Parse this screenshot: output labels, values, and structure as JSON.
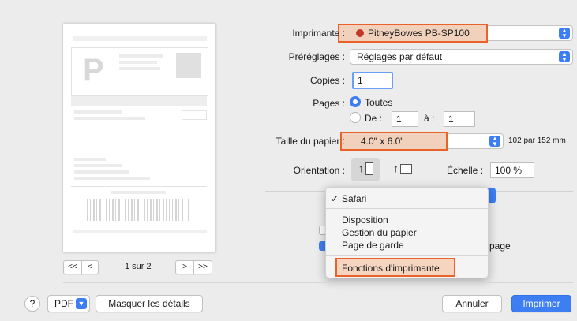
{
  "preview": {
    "logo_letter": "P",
    "page_indicator": "1 sur 2",
    "first_page": "<<",
    "prev_page": "<",
    "next_page": ">",
    "last_page": ">>"
  },
  "printer": {
    "label": "Imprimante :",
    "value": "PitneyBowes PB-SP100"
  },
  "presets": {
    "label": "Préréglages :",
    "value": "Réglages par défaut"
  },
  "copies": {
    "label": "Copies :",
    "value": "1"
  },
  "pages": {
    "label": "Pages :",
    "all_label": "Toutes",
    "from_label": "De :",
    "from_value": "1",
    "to_label": "à :",
    "to_value": "1",
    "selected": "all"
  },
  "paper_size": {
    "label": "Taille du papier :",
    "value": "4.0\" x 6.0\"",
    "dimensions": "102 par 152 mm"
  },
  "orientation": {
    "label": "Orientation :",
    "portrait_icon": "portrait-orientation-icon",
    "landscape_icon": "landscape-orientation-icon",
    "selected": "portrait"
  },
  "scale": {
    "label": "Échelle :",
    "value": "100 %"
  },
  "behind_menu": {
    "trailing_text": "page"
  },
  "dropdown_menu": {
    "checked_item": "Safari",
    "items": [
      "Disposition",
      "Gestion du papier",
      "Page de garde"
    ],
    "highlighted_item": "Fonctions d'imprimante"
  },
  "footer": {
    "help": "?",
    "pdf": "PDF",
    "hide_details": "Masquer les détails",
    "cancel": "Annuler",
    "print": "Imprimer"
  },
  "colors": {
    "accent": "#3d7ef2",
    "highlight_border": "#e8622a",
    "highlight_fill": "#f6bc96",
    "printer_dot": "#c0392b"
  }
}
